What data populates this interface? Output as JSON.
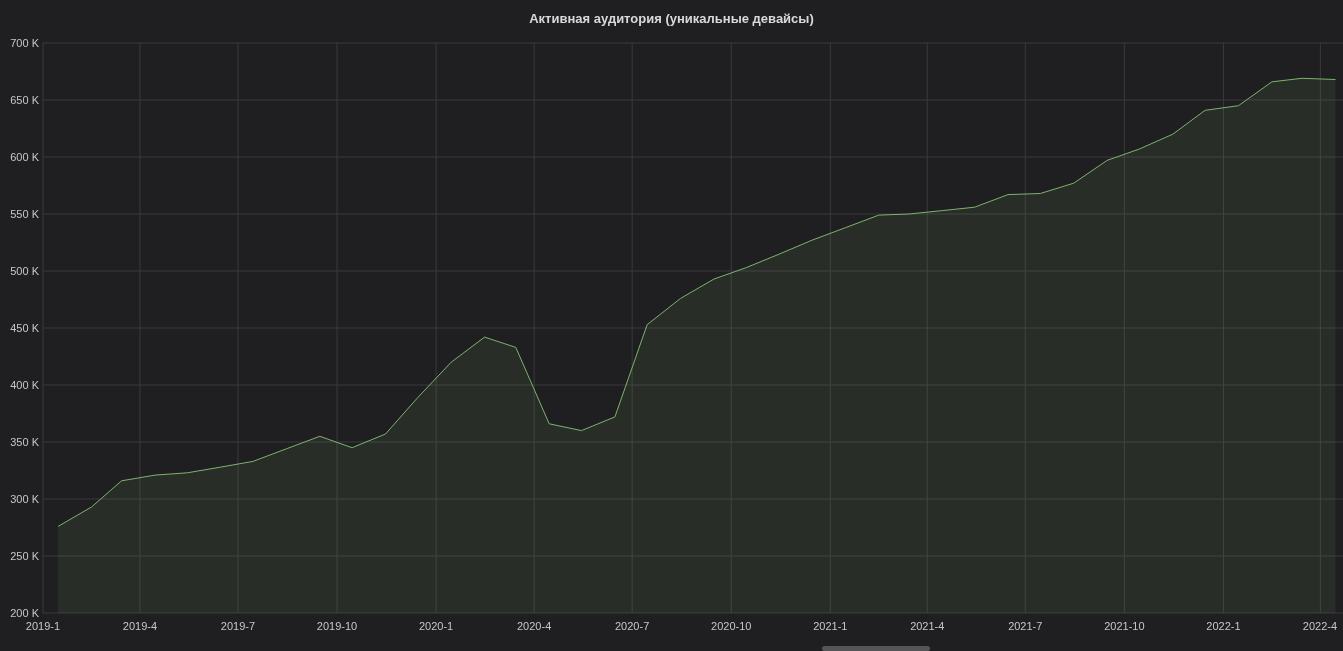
{
  "panel": {
    "title": "Активная аудитория (уникальные девайсы)",
    "chart_data": {
      "type": "area",
      "grid": true,
      "x": [
        "2019-01-15",
        "2019-02-15",
        "2019-03-15",
        "2019-04-15",
        "2019-05-15",
        "2019-06-15",
        "2019-07-15",
        "2019-08-15",
        "2019-09-15",
        "2019-10-15",
        "2019-11-15",
        "2019-12-15",
        "2020-01-15",
        "2020-02-15",
        "2020-03-15",
        "2020-04-15",
        "2020-05-15",
        "2020-06-15",
        "2020-07-15",
        "2020-08-15",
        "2020-09-15",
        "2020-10-15",
        "2020-11-15",
        "2020-12-15",
        "2021-01-15",
        "2021-02-15",
        "2021-03-15",
        "2021-04-15",
        "2021-05-15",
        "2021-06-15",
        "2021-07-15",
        "2021-08-15",
        "2021-09-15",
        "2021-10-15",
        "2021-11-15",
        "2021-12-15",
        "2022-01-15",
        "2022-02-15",
        "2022-03-15",
        "2022-04-15"
      ],
      "series": [
        {
          "color": "#7eb26d",
          "values": [
            276000,
            293000,
            316000,
            321000,
            323000,
            328000,
            333000,
            344000,
            355000,
            345000,
            357000,
            389000,
            420000,
            442000,
            433000,
            366000,
            360000,
            372000,
            453000,
            476000,
            493000,
            503000,
            515000,
            527000,
            538000,
            549000,
            550000,
            553000,
            556000,
            567000,
            568000,
            577000,
            597000,
            607000,
            620000,
            641000,
            645000,
            666000,
            669000,
            668000
          ]
        }
      ],
      "xlim": [
        "2019-01-01",
        "2022-04-22"
      ],
      "ylim": [
        200000,
        700000
      ],
      "xticks": [
        {
          "value": "2019-01-01",
          "label": "2019-1"
        },
        {
          "value": "2019-04-01",
          "label": "2019-4"
        },
        {
          "value": "2019-07-01",
          "label": "2019-7"
        },
        {
          "value": "2019-10-01",
          "label": "2019-10"
        },
        {
          "value": "2020-01-01",
          "label": "2020-1"
        },
        {
          "value": "2020-04-01",
          "label": "2020-4"
        },
        {
          "value": "2020-07-01",
          "label": "2020-7"
        },
        {
          "value": "2020-10-01",
          "label": "2020-10"
        },
        {
          "value": "2021-01-01",
          "label": "2021-1"
        },
        {
          "value": "2021-04-01",
          "label": "2021-4"
        },
        {
          "value": "2021-07-01",
          "label": "2021-7"
        },
        {
          "value": "2021-10-01",
          "label": "2021-10"
        },
        {
          "value": "2022-01-01",
          "label": "2022-1"
        },
        {
          "value": "2022-04-01",
          "label": "2022-4"
        }
      ],
      "yticks": [
        {
          "value": 200000,
          "label": "200 K"
        },
        {
          "value": 250000,
          "label": "250 K"
        },
        {
          "value": 300000,
          "label": "300 K"
        },
        {
          "value": 350000,
          "label": "350 K"
        },
        {
          "value": 400000,
          "label": "400 K"
        },
        {
          "value": 450000,
          "label": "450 K"
        },
        {
          "value": 500000,
          "label": "500 K"
        },
        {
          "value": 550000,
          "label": "550 K"
        },
        {
          "value": 600000,
          "label": "600 K"
        },
        {
          "value": 650000,
          "label": "650 K"
        },
        {
          "value": 700000,
          "label": "700 K"
        }
      ]
    }
  }
}
